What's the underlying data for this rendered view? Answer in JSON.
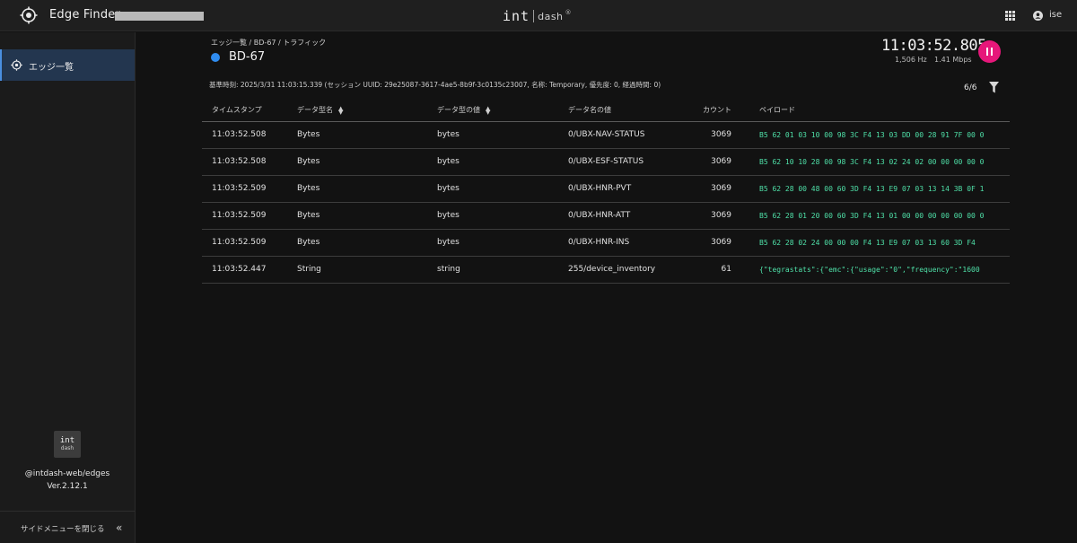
{
  "header": {
    "app_title": "Edge Finder",
    "brand_int": "int",
    "brand_dash": "dash",
    "brand_reg": "®",
    "user_name": "ise"
  },
  "sidebar": {
    "items": [
      {
        "label": "エッジ一覧",
        "active": true
      }
    ],
    "logo_int": "int",
    "logo_dash": "dash",
    "package_name": "@intdash-web/edges",
    "version": "Ver.2.12.1",
    "close_menu_label": "サイドメニューを閉じる",
    "collapse_glyph": "«"
  },
  "main": {
    "breadcrumb": "エッジ一覧 / BD-67 / トラフィック",
    "edge_name": "BD-67",
    "status_color": "#2f8cf0",
    "clock": "11:03:52.805",
    "rate_hz": "1,506 Hz",
    "rate_mbps": "1.41 Mbps",
    "pause_color": "#e6177a",
    "session_info": "基準時刻: 2025/3/31 11:03:15.339 (セッション UUID: 29e25087-3617-4ae5-8b9f-3c0135c23007, 名称: Temporary, 優先度: 0, 経過時間: 0)",
    "count_display": "6/6"
  },
  "table": {
    "headers": {
      "timestamp": "タイムスタンプ",
      "data_type_name": "データ型名",
      "data_type_value": "データ型の値",
      "data_name_value": "データ名の値",
      "count": "カウント",
      "payload": "ペイロード"
    },
    "rows": [
      {
        "timestamp": "11:03:52.508",
        "type_name": "Bytes",
        "type_value": "bytes",
        "data_name": "0/UBX-NAV-STATUS",
        "count": "3069",
        "payload": "B5 62 01 03 10 00 98 3C F4 13 03 DD 00 28 91 7F 00 0"
      },
      {
        "timestamp": "11:03:52.508",
        "type_name": "Bytes",
        "type_value": "bytes",
        "data_name": "0/UBX-ESF-STATUS",
        "count": "3069",
        "payload": "B5 62 10 10 28 00 98 3C F4 13 02 24 02 00 00 00 00 0"
      },
      {
        "timestamp": "11:03:52.509",
        "type_name": "Bytes",
        "type_value": "bytes",
        "data_name": "0/UBX-HNR-PVT",
        "count": "3069",
        "payload": "B5 62 28 00 48 00 60 3D F4 13 E9 07 03 13 14 3B 0F 1"
      },
      {
        "timestamp": "11:03:52.509",
        "type_name": "Bytes",
        "type_value": "bytes",
        "data_name": "0/UBX-HNR-ATT",
        "count": "3069",
        "payload": "B5 62 28 01 20 00 60 3D F4 13 01 00 00 00 00 00 00 0"
      },
      {
        "timestamp": "11:03:52.509",
        "type_name": "Bytes",
        "type_value": "bytes",
        "data_name": "0/UBX-HNR-INS",
        "count": "3069",
        "payload": "B5 62 28 02 24 00 00 00 F4 13 E9 07 03 13 60 3D F4"
      },
      {
        "timestamp": "11:03:52.447",
        "type_name": "String",
        "type_value": "string",
        "data_name": "255/device_inventory",
        "count": "61",
        "payload": "{\"tegrastats\":{\"emc\":{\"usage\":\"0\",\"frequency\":\"1600"
      }
    ]
  }
}
